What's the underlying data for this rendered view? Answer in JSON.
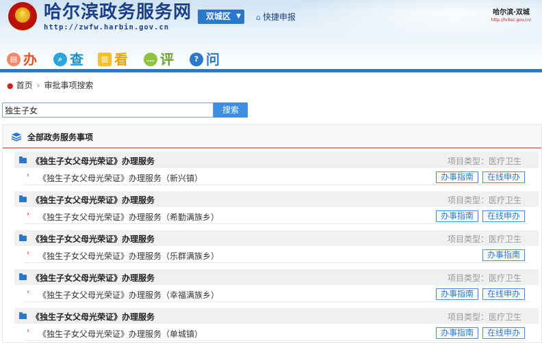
{
  "header": {
    "site_title": "哈尔滨政务服务网",
    "site_url": "http://zwfw.harbin.gov.cn",
    "district": "双城区",
    "quick_link": "快捷申报",
    "corner_name": "哈尔滨·双城",
    "corner_url": "http://hrbsc.gov.cn/"
  },
  "nav": [
    {
      "label": "办",
      "icon": "document-icon"
    },
    {
      "label": "查",
      "icon": "search-icon"
    },
    {
      "label": "看",
      "icon": "book-icon"
    },
    {
      "label": "评",
      "icon": "comment-icon"
    },
    {
      "label": "问",
      "icon": "question-icon"
    }
  ],
  "breadcrumb": {
    "home": "首页",
    "current": "审批事项搜索"
  },
  "search": {
    "value": "独生子女",
    "button": "搜索"
  },
  "panel": {
    "title": "全部政务服务事项"
  },
  "groups": [
    {
      "title": "《独生子女父母光荣证》办理服务",
      "type": "项目类型：医疗卫生",
      "item": "《独生子女父母光荣证》办理服务（新兴镇）",
      "guide": "办事指南",
      "online": "在线申办"
    },
    {
      "title": "《独生子女父母光荣证》办理服务",
      "type": "项目类型：医疗卫生",
      "item": "《独生子女父母光荣证》办理服务（希勤满族乡）",
      "guide": "办事指南",
      "online": "在线申办"
    },
    {
      "title": "《独生子女父母光荣证》办理服务",
      "type": "项目类型：医疗卫生",
      "item": "《独生子女父母光荣证》办理服务（乐群满族乡）",
      "guide": "办事指南",
      "online": null
    },
    {
      "title": "《独生子女父母光荣证》办理服务",
      "type": "项目类型：医疗卫生",
      "item": "《独生子女父母光荣证》办理服务（幸福满族乡）",
      "guide": "办事指南",
      "online": "在线申办"
    },
    {
      "title": "《独生子女父母光荣证》办理服务",
      "type": "项目类型：医疗卫生",
      "item": "《独生子女父母光荣证》办理服务（单城镇）",
      "guide": "办事指南",
      "online": "在线申办"
    }
  ]
}
